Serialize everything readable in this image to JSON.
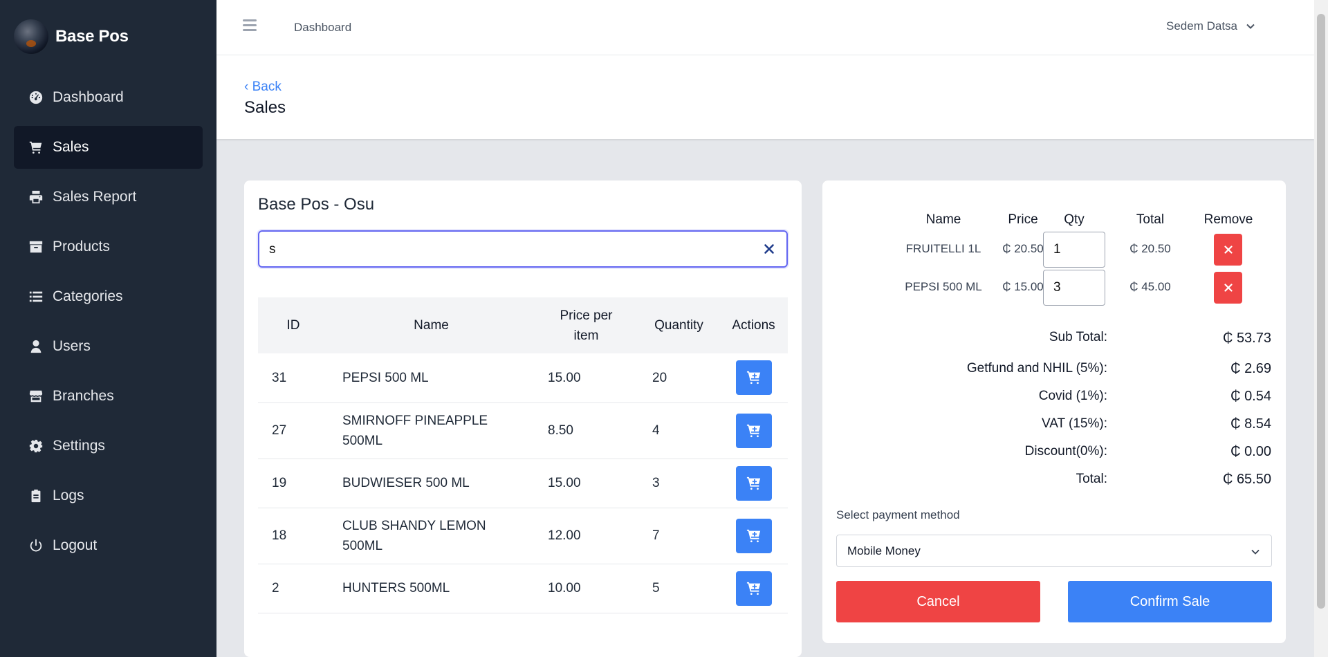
{
  "brand": {
    "name": "Base Pos"
  },
  "sidebar": {
    "items": [
      {
        "label": "Dashboard",
        "icon": "dashboard-icon"
      },
      {
        "label": "Sales",
        "icon": "cart-icon",
        "active": true
      },
      {
        "label": "Sales Report",
        "icon": "printer-icon"
      },
      {
        "label": "Products",
        "icon": "box-icon"
      },
      {
        "label": "Categories",
        "icon": "list-icon"
      },
      {
        "label": "Users",
        "icon": "user-icon"
      },
      {
        "label": "Branches",
        "icon": "store-icon"
      },
      {
        "label": "Settings",
        "icon": "gear-icon"
      },
      {
        "label": "Logs",
        "icon": "clipboard-icon"
      },
      {
        "label": "Logout",
        "icon": "power-icon"
      }
    ]
  },
  "topbar": {
    "breadcrumb": "Dashboard",
    "user_name": "Sedem Datsa"
  },
  "header": {
    "back_label": "‹ Back",
    "title": "Sales"
  },
  "products_panel": {
    "title": "Base Pos - Osu",
    "search": {
      "value": "s"
    },
    "columns": {
      "id": "ID",
      "name": "Name",
      "price_line1": "Price per",
      "price_line2": "item",
      "qty": "Quantity",
      "actions": "Actions"
    },
    "rows": [
      {
        "id": "31",
        "name": "PEPSI 500 ML",
        "name2": "",
        "price": "15.00",
        "qty": "20"
      },
      {
        "id": "27",
        "name": "SMIRNOFF PINEAPPLE",
        "name2": "500ML",
        "price": "8.50",
        "qty": "4"
      },
      {
        "id": "19",
        "name": "BUDWIESER 500 ML",
        "name2": "",
        "price": "15.00",
        "qty": "3"
      },
      {
        "id": "18",
        "name": "CLUB SHANDY LEMON",
        "name2": "500ML",
        "price": "12.00",
        "qty": "7"
      },
      {
        "id": "2",
        "name": "HUNTERS 500ML",
        "name2": "",
        "price": "10.00",
        "qty": "5"
      }
    ]
  },
  "cart": {
    "columns": {
      "name": "Name",
      "price": "Price",
      "qty": "Qty",
      "total": "Total",
      "remove": "Remove"
    },
    "items": [
      {
        "name": "FRUITELLI 1L",
        "price": "₵ 20.50",
        "qty": "1",
        "total": "₵ 20.50"
      },
      {
        "name": "PEPSI 500 ML",
        "price": "₵ 15.00",
        "qty": "3",
        "total": "₵ 45.00"
      }
    ],
    "summary": {
      "subtotal_label": "Sub Total:",
      "subtotal": "₵ 53.73",
      "getfund_label": "Getfund and NHIL (5%):",
      "getfund": "₵ 2.69",
      "covid_label": "Covid (1%):",
      "covid": "₵ 0.54",
      "vat_label": "VAT (15%):",
      "vat": "₵ 8.54",
      "discount_label": "Discount(0%):",
      "discount": "₵ 0.00",
      "total_label": "Total:",
      "total": "₵ 65.50"
    },
    "payment": {
      "label": "Select payment method",
      "selected": "Mobile Money"
    },
    "cancel_label": "Cancel",
    "confirm_label": "Confirm Sale"
  },
  "colors": {
    "sidebar": "#1f2937",
    "sidebar_active": "#111827",
    "primary": "#3b82f6",
    "danger": "#ef4444",
    "focus": "#6366f1"
  }
}
